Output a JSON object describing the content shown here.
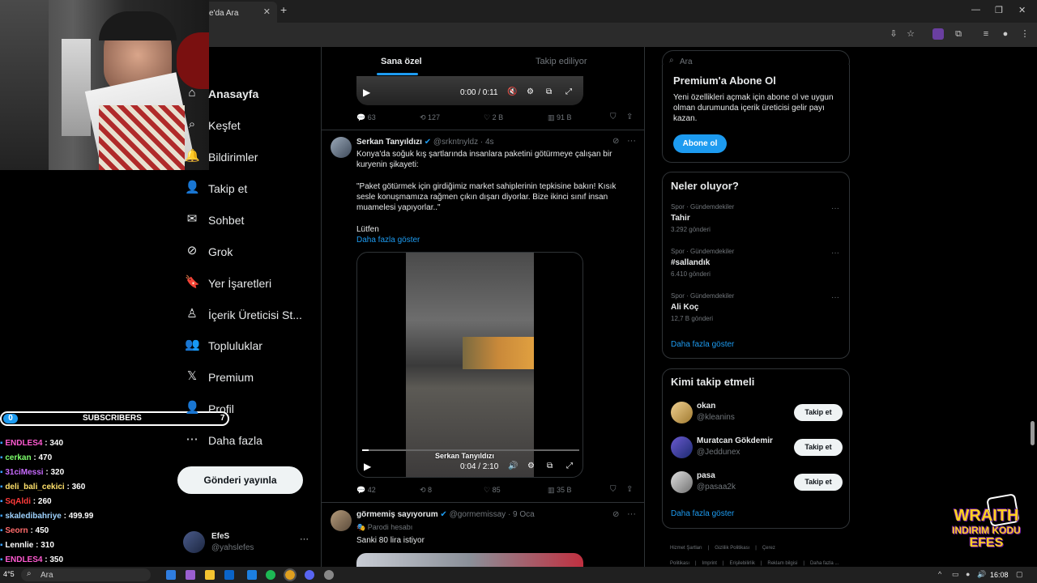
{
  "browser": {
    "tab_title": "e'da Ara",
    "new_tab": "+",
    "close_tab": "✕",
    "window_controls": [
      "—",
      "❐",
      "✕"
    ]
  },
  "nav": {
    "items": [
      {
        "label": "Anasayfa",
        "icon": "home-icon",
        "glyph": "⌂",
        "active": true
      },
      {
        "label": "Keşfet",
        "icon": "search-icon",
        "glyph": "⌕"
      },
      {
        "label": "Bildirimler",
        "icon": "bell-icon",
        "glyph": "🔔"
      },
      {
        "label": "Takip et",
        "icon": "add-person-icon",
        "glyph": "👤"
      },
      {
        "label": "Sohbet",
        "icon": "mail-icon",
        "glyph": "✉"
      },
      {
        "label": "Grok",
        "icon": "grok-icon",
        "glyph": "⊘"
      },
      {
        "label": "Yer İşaretleri",
        "icon": "bookmark-icon",
        "glyph": "🔖"
      },
      {
        "label": "İçerik Üreticisi St...",
        "icon": "creator-icon",
        "glyph": "♙"
      },
      {
        "label": "Topluluklar",
        "icon": "communities-icon",
        "glyph": "👥"
      },
      {
        "label": "Premium",
        "icon": "x-logo-icon",
        "glyph": "𝕏"
      },
      {
        "label": "Profil",
        "icon": "profile-icon",
        "glyph": "👤"
      },
      {
        "label": "Daha fazla",
        "icon": "more-circle-icon",
        "glyph": "⋯"
      }
    ],
    "post_button": "Gönderi yayınla",
    "account": {
      "name": "EfeS",
      "handle": "@yahslefes",
      "more": "···"
    }
  },
  "feed": {
    "tabs": [
      "Sana özel",
      "Takip ediliyor"
    ],
    "post1": {
      "time": "0:00 / 0:11",
      "actions": {
        "replies": "63",
        "reposts": "127",
        "likes": "2 B",
        "views": "91 B"
      }
    },
    "post2": {
      "author": "Serkan Tanyıldızı",
      "handle": "@srkntnyldz",
      "time": "· 4s",
      "text1": "Konya'da soğuk kış şartlarında insanlara paketini götürmeye çalışan bir kuryenin şikayeti:",
      "text2": "\"Paket götürmek için girdiğimiz market sahiplerinin tepkisine bakın! Kısık sesle konuşmamıza rağmen çıkın dışarı diyorlar. Bize ikinci sınıf insan muamelesi yapıyorlar..\"",
      "text3": "Lütfen",
      "show_more": "Daha fazla göster",
      "video_caption": "Serkan Tanyıldızı",
      "video_time": "0:04 / 2:10",
      "video_progress": 0.03,
      "actions": {
        "replies": "42",
        "reposts": "8",
        "likes": "85",
        "views": "35 B"
      }
    },
    "post3": {
      "author": "görmemiş sayıyorum",
      "handle": "@gormemissay",
      "time": "· 9 Oca",
      "badge": "Parodi hesabı",
      "text": "Sanki 80 lira istiyor"
    }
  },
  "right": {
    "search_placeholder": "Ara",
    "premium": {
      "title": "Premium'a Abone Ol",
      "text": "Yeni özellikleri açmak için abone ol ve uygun olman durumunda içerik üreticisi gelir payı kazan.",
      "button": "Abone ol"
    },
    "trends": {
      "title": "Neler oluyor?",
      "items": [
        {
          "category": "Spor · Gündemdekiler",
          "name": "Tahir",
          "count": "3.292 gönderi"
        },
        {
          "category": "Spor · Gündemdekiler",
          "name": "#sallandık",
          "count": "6.410 gönderi"
        },
        {
          "category": "Spor · Gündemdekiler",
          "name": "Ali Koç",
          "count": "12,7 B gönderi"
        }
      ],
      "show_more": "Daha fazla göster"
    },
    "who_to_follow": {
      "title": "Kimi takip etmeli",
      "users": [
        {
          "name": "okan",
          "handle": "@kleanins",
          "button": "Takip et"
        },
        {
          "name": "Muratcan Gökdemir",
          "handle": "@Jeddunex",
          "button": "Takip et"
        },
        {
          "name": "pasa",
          "handle": "@pasaa2k",
          "button": "Takip et"
        }
      ],
      "show_more": "Daha fazla göster"
    },
    "footer": [
      "Hizmet Şartları",
      "|",
      "Gizlilik Politikası",
      "|",
      "Çerez Politikası",
      "|",
      "Imprint",
      "|",
      "Erişilebilirlik",
      "|",
      "Reklam bilgisi",
      "|",
      "Daha fazla ..."
    ]
  },
  "overlay": {
    "subscribers_label": "SUBSCRIBERS",
    "subscribers_left": "0",
    "subscribers_right": "7",
    "subs": [
      {
        "name": "ENDLES4",
        "value": ": 340",
        "color": "#ff5ad1"
      },
      {
        "name": "cerkan",
        "value": ": 470",
        "color": "#7cff6b"
      },
      {
        "name": "31ciMessi",
        "value": ": 320",
        "color": "#c86bff"
      },
      {
        "name": "deli_bali_cekici",
        "value": ": 360",
        "color": "#ffe16b"
      },
      {
        "name": "SqAldi",
        "value": ": 260",
        "color": "#ff3b3b"
      },
      {
        "name": "skaledibahriye",
        "value": ": 499.99",
        "color": "#9fd3ff"
      },
      {
        "name": "Seorn",
        "value": ": 450",
        "color": "#ff6b6b"
      },
      {
        "name": "Lennlie",
        "value": ": 310",
        "color": "#ffffff"
      },
      {
        "name": "ENDLES4",
        "value": ": 350",
        "color": "#ff5ad1"
      }
    ],
    "wraith_line1": "WRAITH",
    "wraith_line2": "INDIRIM KODU",
    "wraith_line3": "EFES"
  },
  "taskbar": {
    "search": "Ara",
    "temp": "4°5",
    "time": "16:08"
  }
}
